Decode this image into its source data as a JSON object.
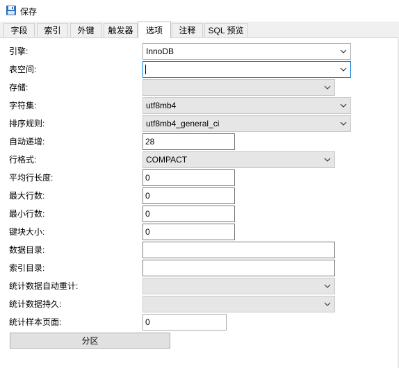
{
  "toolbar": {
    "save_label": "保存"
  },
  "tabs": [
    {
      "label": "字段"
    },
    {
      "label": "索引"
    },
    {
      "label": "外键"
    },
    {
      "label": "触发器"
    },
    {
      "label": "选项"
    },
    {
      "label": "注释"
    },
    {
      "label": "SQL 预览"
    }
  ],
  "active_tab": "选项",
  "options": {
    "engine": {
      "label": "引擎:",
      "value": "InnoDB"
    },
    "tablespace": {
      "label": "表空间:",
      "value": ""
    },
    "storage": {
      "label": "存储:",
      "value": ""
    },
    "charset": {
      "label": "字符集:",
      "value": "utf8mb4"
    },
    "collation": {
      "label": "排序规则:",
      "value": "utf8mb4_general_ci"
    },
    "auto_increment": {
      "label": "自动递增:",
      "value": "28"
    },
    "row_format": {
      "label": "行格式:",
      "value": "COMPACT"
    },
    "avg_row_length": {
      "label": "平均行长度:",
      "value": "0"
    },
    "max_rows": {
      "label": "最大行数:",
      "value": "0"
    },
    "min_rows": {
      "label": "最小行数:",
      "value": "0"
    },
    "key_block_size": {
      "label": "键块大小:",
      "value": "0"
    },
    "data_directory": {
      "label": "数据目录:",
      "value": ""
    },
    "index_directory": {
      "label": "索引目录:",
      "value": ""
    },
    "stats_auto_recalc": {
      "label": "统计数据自动重计:",
      "value": ""
    },
    "stats_persistent": {
      "label": "统计数据持久:",
      "value": ""
    },
    "stats_sample_pages": {
      "label": "统计样本页面:",
      "value": "0"
    }
  },
  "partition_button": {
    "label": "分区"
  },
  "colors": {
    "focus": "#0078d7",
    "disabled_bg": "#e6e6e6",
    "button_bg": "#e1e1e1"
  }
}
